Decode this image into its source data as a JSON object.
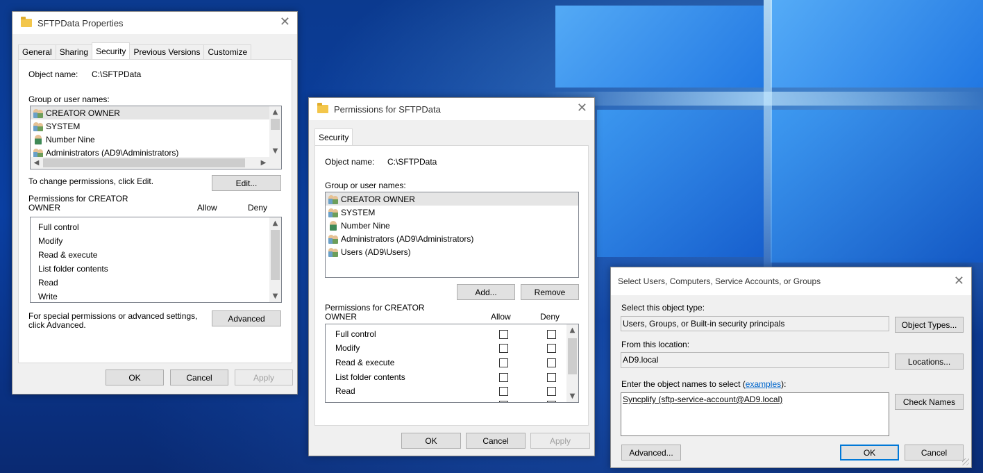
{
  "props": {
    "title": "SFTPData Properties",
    "tabs": [
      "General",
      "Sharing",
      "Security",
      "Previous Versions",
      "Customize"
    ],
    "object_label": "Object name:",
    "object_value": "C:\\SFTPData",
    "group_label": "Group or user names:",
    "users": [
      "CREATOR OWNER",
      "SYSTEM",
      "Number Nine",
      "Administrators (AD9\\Administrators)"
    ],
    "change_text": "To change permissions, click Edit.",
    "edit_button": "Edit...",
    "perm_header_line1": "Permissions for CREATOR",
    "perm_header_line2": "OWNER",
    "allow": "Allow",
    "deny": "Deny",
    "permissions": [
      "Full control",
      "Modify",
      "Read & execute",
      "List folder contents",
      "Read",
      "Write"
    ],
    "special_line1": "For special permissions or advanced settings,",
    "special_line2": "click Advanced.",
    "advanced_button": "Advanced",
    "ok": "OK",
    "cancel": "Cancel",
    "apply": "Apply"
  },
  "perm_dialog": {
    "title": "Permissions for SFTPData",
    "tab": "Security",
    "object_label": "Object name:",
    "object_value": "C:\\SFTPData",
    "group_label": "Group or user names:",
    "users": [
      "CREATOR OWNER",
      "SYSTEM",
      "Number Nine",
      "Administrators (AD9\\Administrators)",
      "Users (AD9\\Users)"
    ],
    "add_button": "Add...",
    "remove_button": "Remove",
    "perm_header_line1": "Permissions for CREATOR",
    "perm_header_line2": "OWNER",
    "allow": "Allow",
    "deny": "Deny",
    "permissions": [
      "Full control",
      "Modify",
      "Read & execute",
      "List folder contents",
      "Read"
    ],
    "ok": "OK",
    "cancel": "Cancel",
    "apply": "Apply"
  },
  "select_dialog": {
    "title": "Select Users, Computers, Service Accounts, or Groups",
    "object_type_label": "Select this object type:",
    "object_type_value": "Users, Groups, or Built-in security principals",
    "object_types_button": "Object Types...",
    "location_label": "From this location:",
    "location_value": "AD9.local",
    "locations_button": "Locations...",
    "enter_label": "Enter the object names to select (",
    "examples_link": "examples",
    "enter_label_end": "):",
    "entered_value": "Syncplify (sftp-service-account@AD9.local)",
    "check_names_button": "Check Names",
    "advanced_button": "Advanced...",
    "ok": "OK",
    "cancel": "Cancel"
  }
}
